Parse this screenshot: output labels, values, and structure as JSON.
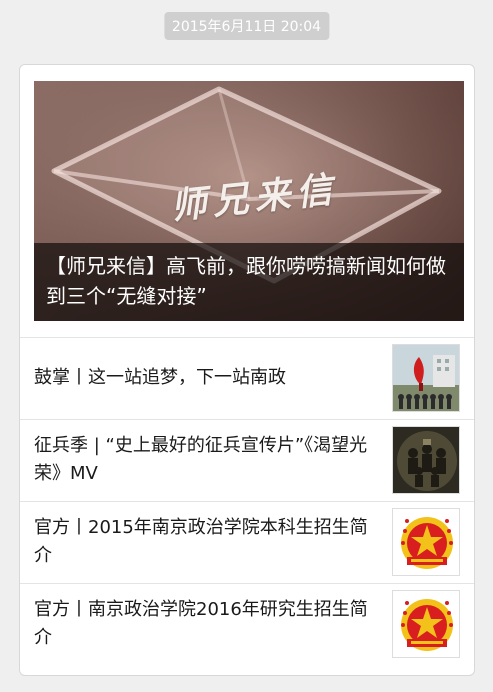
{
  "timestamp": "2015年6月11日 20:04",
  "hero": {
    "calligraphy": "师兄来信",
    "title": "【师兄来信】高飞前，跟你唠唠搞新闻如何做到三个“无缝对接”"
  },
  "articles": [
    {
      "title": "鼓掌丨这一站追梦，下一站南政",
      "thumb_icon": "campus-sculpture-icon"
    },
    {
      "title": "征兵季 | “史上最好的征兵宣传片”《渴望光荣》MV",
      "thumb_icon": "soldiers-group-icon"
    },
    {
      "title": "官方丨2015年南京政治学院本科生招生简介",
      "thumb_icon": "college-emblem-icon"
    },
    {
      "title": "官方丨南京政治学院2016年研究生招生简介",
      "thumb_icon": "college-emblem-icon"
    }
  ],
  "colors": {
    "background": "#efefef",
    "card": "#ffffff",
    "timestamp_bg": "#cfcfcf",
    "emblem_red": "#d81e1e",
    "emblem_gold": "#f2c21a"
  }
}
